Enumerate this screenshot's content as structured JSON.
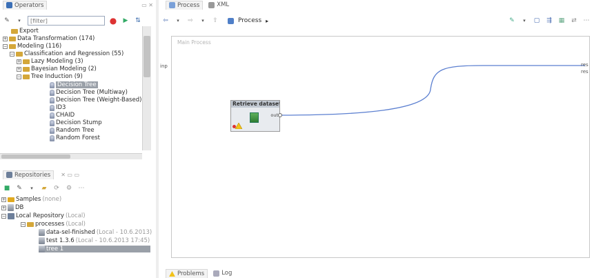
{
  "operators_panel": {
    "tab_label": "Operators",
    "search_placeholder": "[filter]",
    "tree": [
      {
        "label": "Export",
        "kind": "folder"
      },
      {
        "label": "Data Transformation (174)",
        "kind": "folder"
      },
      {
        "label": "Modeling (116)",
        "kind": "folder"
      },
      {
        "label": "Classification and Regression (55)",
        "kind": "folder"
      },
      {
        "label": "Lazy Modeling (3)",
        "kind": "folder"
      },
      {
        "label": "Bayesian Modeling (2)",
        "kind": "folder"
      },
      {
        "label": "Tree Induction (9)",
        "kind": "folder"
      },
      {
        "label": "Decision Tree",
        "kind": "op",
        "selected": true
      },
      {
        "label": "Decision Tree (Multiway)",
        "kind": "op"
      },
      {
        "label": "Decision Tree (Weight-Based)",
        "kind": "op"
      },
      {
        "label": "ID3",
        "kind": "op"
      },
      {
        "label": "CHAID",
        "kind": "op"
      },
      {
        "label": "Decision Stump",
        "kind": "op"
      },
      {
        "label": "Random Tree",
        "kind": "op"
      },
      {
        "label": "Random Forest",
        "kind": "op"
      }
    ]
  },
  "repositories_panel": {
    "tab_label": "Repositories",
    "tree": [
      {
        "label": "Samples",
        "note": "(none)"
      },
      {
        "label": "DB",
        "note": ""
      },
      {
        "label": "Local Repository",
        "note": "(Local)"
      },
      {
        "label": "processes",
        "note": "(Local)"
      },
      {
        "label": "data-sel-finished",
        "note": "(Local - 10.6.2013)"
      },
      {
        "label": "test 1.3.6",
        "note": "(Local - 10.6.2013 17:45)"
      },
      {
        "label": "tree 1",
        "note": "",
        "selected": true
      }
    ]
  },
  "editor": {
    "tabs": [
      "Process",
      "XML"
    ],
    "breadcrumb": "Process",
    "canvas_label": "Main Process",
    "operator": {
      "title": "Retrieve dataset",
      "port_label": "out"
    },
    "input_port_label": "inp",
    "output_port_labels": [
      "res",
      "res"
    ]
  },
  "bottom_tabs": [
    "Problems",
    "Log"
  ],
  "colors": {
    "canvas_border": "#c7c7c7",
    "selection": "#9aa0a8",
    "folder": "#d4a73a",
    "connection": "#5b7fd0"
  }
}
